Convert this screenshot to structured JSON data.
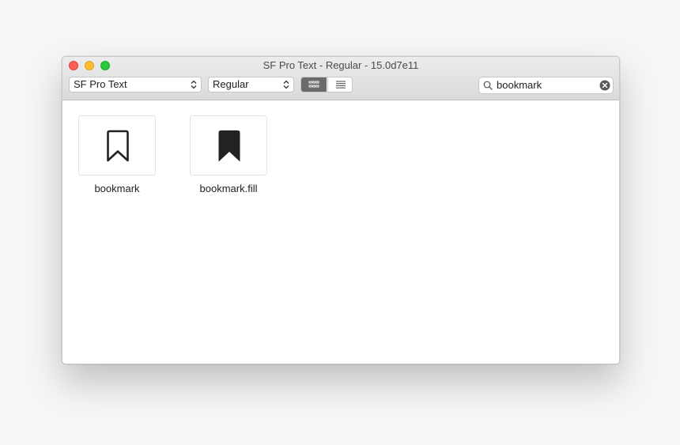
{
  "window": {
    "title": "SF Pro Text - Regular - 15.0d7e11"
  },
  "toolbar": {
    "font_family": "SF Pro Text",
    "font_weight": "Regular",
    "view_modes": [
      "grid",
      "list"
    ],
    "selected_view": "grid",
    "search_value": "bookmark"
  },
  "results": [
    {
      "label": "bookmark",
      "icon": "bookmark-icon"
    },
    {
      "label": "bookmark.fill",
      "icon": "bookmark-fill-icon"
    }
  ],
  "colors": {
    "close": "#fe5f57",
    "minimize": "#febc2e",
    "zoom": "#28c840",
    "selected_segment": "#6b6b6b"
  }
}
